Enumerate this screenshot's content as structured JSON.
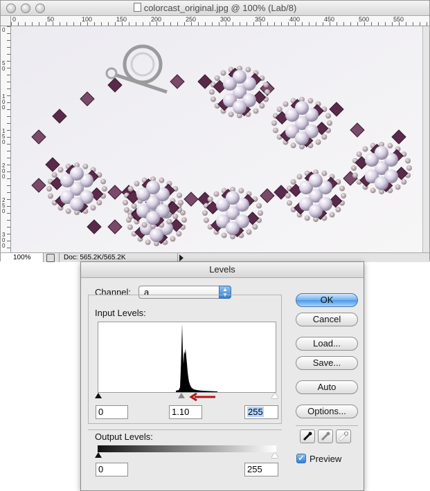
{
  "document_window": {
    "title": "colorcast_original.jpg @ 100% (Lab/8)",
    "ruler_h_labels": [
      "0",
      "50",
      "100",
      "150",
      "200",
      "250",
      "300",
      "350",
      "400",
      "450",
      "500",
      "550"
    ],
    "ruler_v_labels": [
      "0",
      "50",
      "100",
      "150",
      "200",
      "250",
      "300"
    ],
    "status": {
      "zoom": "100%",
      "doc_size": "Doc: 565.2K/565.2K"
    }
  },
  "levels_dialog": {
    "title": "Levels",
    "channel_label": "Channel:",
    "channel_value": "a",
    "input_levels_label": "Input Levels:",
    "input_black": "0",
    "input_gamma": "1.10",
    "input_white": "255",
    "output_levels_label": "Output Levels:",
    "output_black": "0",
    "output_white": "255",
    "buttons": {
      "ok": "OK",
      "cancel": "Cancel",
      "load": "Load...",
      "save": "Save...",
      "auto": "Auto",
      "options": "Options..."
    },
    "preview_label": "Preview",
    "preview_checked": true
  },
  "colors": {
    "accent_blue": "#4b98e5",
    "arrow_red": "#b01818",
    "bead_purple": "#5a2a4a",
    "pearl": "#d8d0e0"
  }
}
